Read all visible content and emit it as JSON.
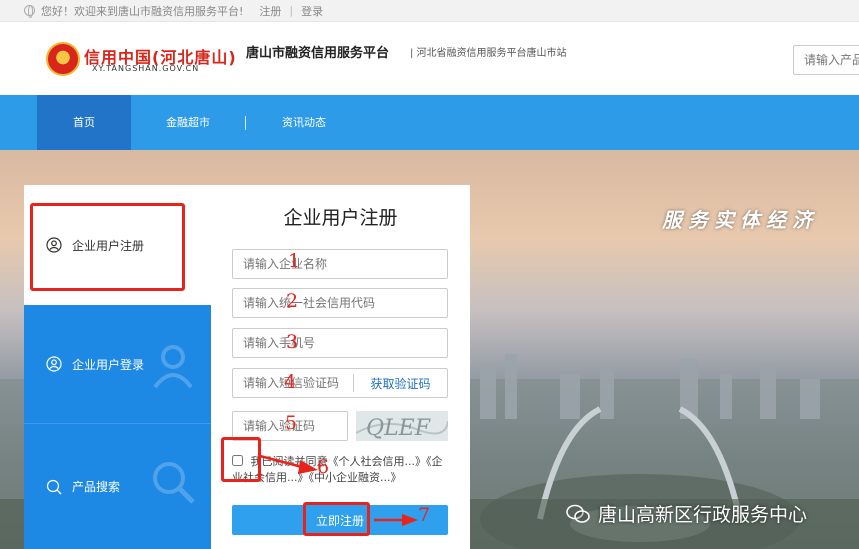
{
  "topbar": {
    "welcome": "您好！欢迎来到唐山市融资信用服务平台!",
    "register": "注册",
    "separator": "|",
    "login": "登录"
  },
  "header": {
    "logo_cn": "信用中国(河北唐山)",
    "logo_en": "XY.TANGSHAN.GOV.CN",
    "title": "唐山市融资信用服务平台",
    "subtitle": "| 河北省融资信用服务平台唐山市站",
    "search_placeholder": "请输入产品"
  },
  "nav": {
    "items": [
      {
        "label": "首页"
      },
      {
        "label": "金融超市"
      },
      {
        "label": "资讯动态"
      }
    ]
  },
  "hero": {
    "slogan": "服务实体经济",
    "watermark": "唐山高新区行政服务中心"
  },
  "tabs": {
    "register": "企业用户注册",
    "login": "企业用户登录",
    "search": "产品搜索"
  },
  "form": {
    "title": "企业用户注册",
    "company_placeholder": "请输入企业名称",
    "credit_code_placeholder": "请输入统一社会信用代码",
    "phone_placeholder": "请输入手机号",
    "sms_placeholder": "请输入短信验证码",
    "sms_button": "获取验证码",
    "captcha_placeholder": "请输入验证码",
    "captcha_text": "QLEF",
    "agree_text": "我已阅读并同意《个人社会信用...》《企业社会信用...》《中小企业融资...》",
    "submit": "立即注册"
  },
  "annotations": {
    "n1": "1",
    "n2": "2",
    "n3": "3",
    "n4": "4",
    "n5": "5",
    "n6": "6",
    "n7": "7"
  },
  "colors": {
    "nav": "#2e9be9",
    "nav_active": "#2174c8",
    "tab_blue": "#1e88e5",
    "annotation": "#e8231c"
  }
}
